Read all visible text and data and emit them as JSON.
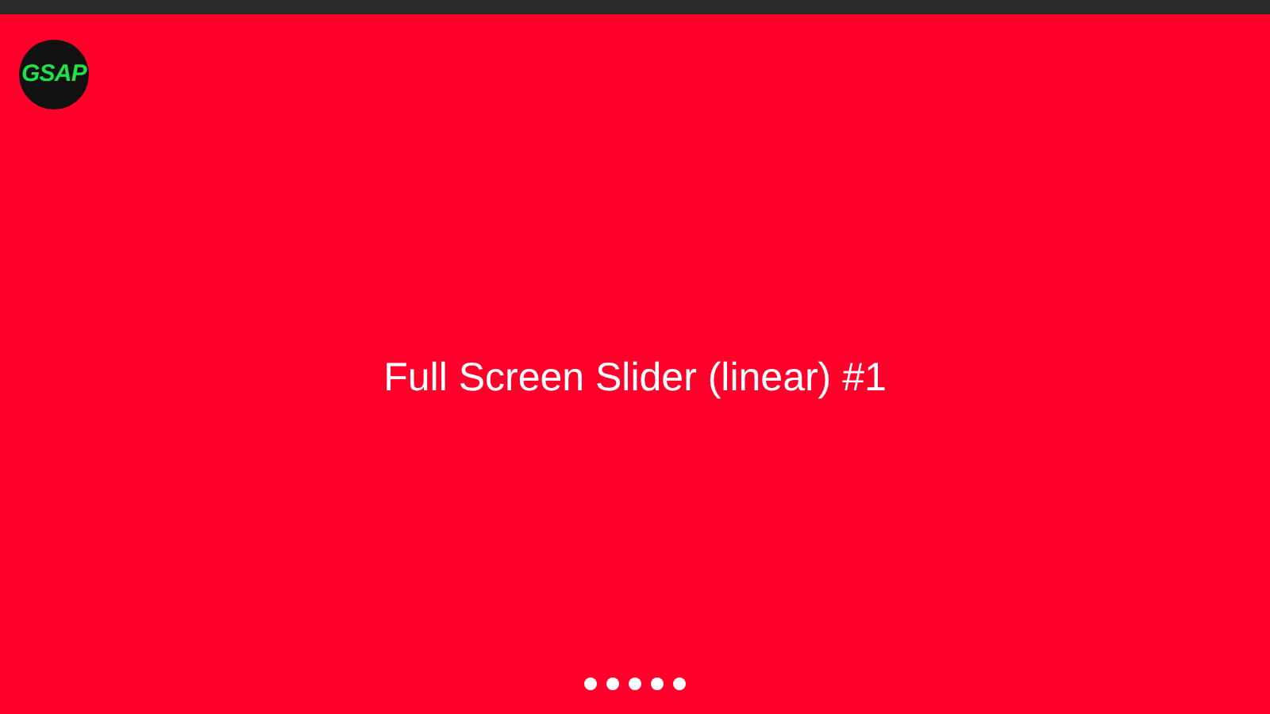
{
  "logo": {
    "text": "GSAP"
  },
  "slide": {
    "title": "Full Screen Slider (linear) #1"
  }
}
